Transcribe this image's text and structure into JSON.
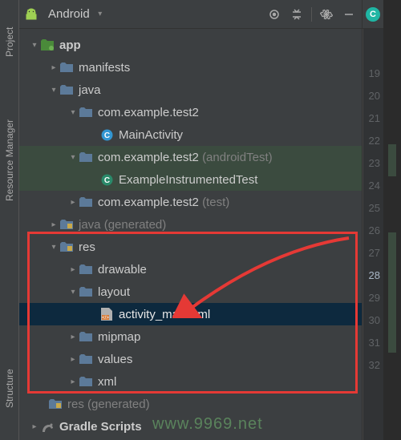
{
  "side_tabs": {
    "project": "Project",
    "resource_manager": "Resource Manager",
    "structure": "Structure"
  },
  "toolbar": {
    "view_label": "Android"
  },
  "tree": {
    "app": "app",
    "manifests": "manifests",
    "java": "java",
    "pkg1": "com.example.test2",
    "main_activity": "MainActivity",
    "pkg2": "com.example.test2",
    "pkg2_suffix": "(androidTest)",
    "example_test": "ExampleInstrumentedTest",
    "pkg3": "com.example.test2",
    "pkg3_suffix": "(test)",
    "java_gen": "java",
    "gen_suffix": "(generated)",
    "res": "res",
    "drawable": "drawable",
    "layout": "layout",
    "activity_main": "activity_main.xml",
    "mipmap": "mipmap",
    "values": "values",
    "xml": "xml",
    "res_gen": "res",
    "gradle": "Gradle Scripts"
  },
  "line_numbers": [
    "19",
    "20",
    "21",
    "22",
    "23",
    "24",
    "25",
    "26",
    "27",
    "28",
    "29",
    "30",
    "31",
    "32"
  ],
  "selected_line": "28",
  "watermark": "www.9969.net"
}
